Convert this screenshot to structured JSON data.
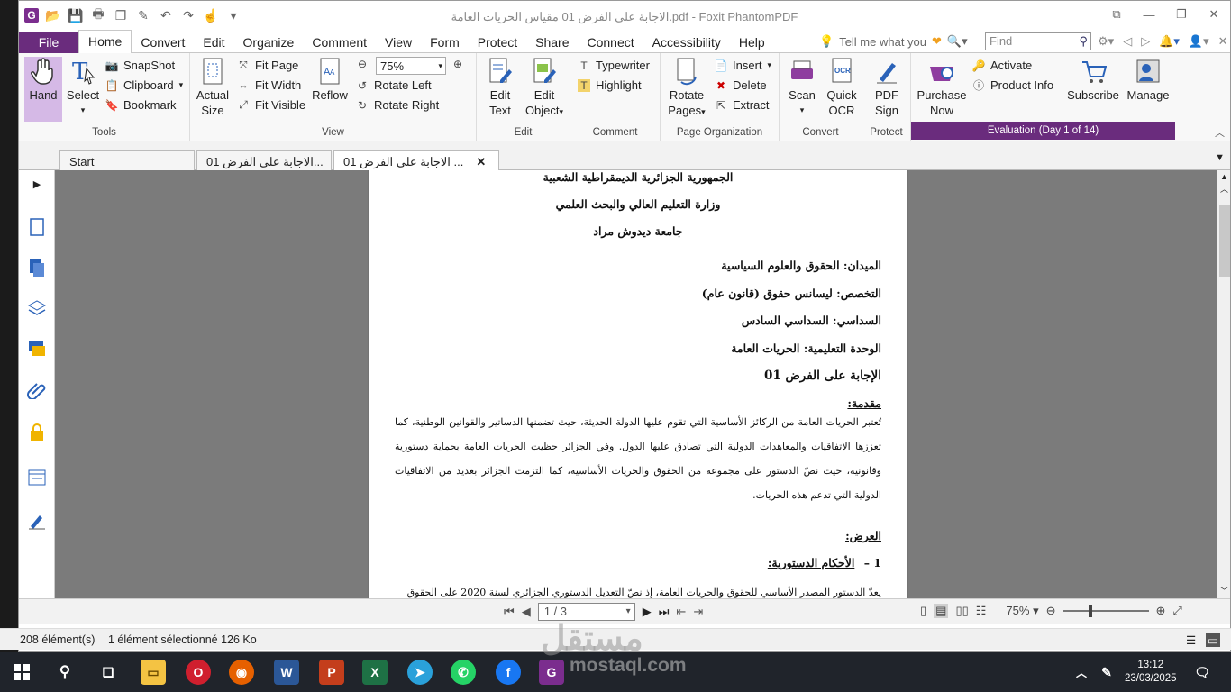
{
  "window": {
    "title": "الاجابة على الفرض 01 مقياس الحريات العامة.pdf - Foxit PhantomPDF"
  },
  "menu": {
    "tabs": [
      "File",
      "Home",
      "Convert",
      "Edit",
      "Organize",
      "Comment",
      "View",
      "Form",
      "Protect",
      "Share",
      "Connect",
      "Accessibility",
      "Help"
    ],
    "tell_me": "Tell me what you",
    "find_placeholder": "Find"
  },
  "ribbon": {
    "tools": {
      "label": "Tools",
      "hand": "Hand",
      "select": "Select",
      "snapshot": "SnapShot",
      "clipboard": "Clipboard",
      "bookmark": "Bookmark"
    },
    "view": {
      "label": "View",
      "actual_size_1": "Actual",
      "actual_size_2": "Size",
      "fit_page": "Fit Page",
      "fit_width": "Fit Width",
      "fit_visible": "Fit Visible",
      "reflow": "Reflow",
      "zoom": "75%",
      "rotate_left": "Rotate Left",
      "rotate_right": "Rotate Right"
    },
    "edit": {
      "label": "Edit",
      "edit_text_1": "Edit",
      "edit_text_2": "Text",
      "edit_object_1": "Edit",
      "edit_object_2": "Object"
    },
    "comment": {
      "label": "Comment",
      "typewriter": "Typewriter",
      "highlight": "Highlight"
    },
    "organize": {
      "label": "Page Organization",
      "rotate_pages_1": "Rotate",
      "rotate_pages_2": "Pages",
      "insert": "Insert",
      "delete": "Delete",
      "extract": "Extract"
    },
    "convert": {
      "label": "Convert",
      "scan": "Scan",
      "quick_ocr_1": "Quick",
      "quick_ocr_2": "OCR"
    },
    "protect": {
      "label": "Protect",
      "pdf_sign_1": "PDF",
      "pdf_sign_2": "Sign"
    },
    "purchase": {
      "purchase_1": "Purchase",
      "purchase_2": "Now",
      "activate": "Activate",
      "product_info": "Product Info",
      "subscribe": "Subscribe",
      "manage": "Manage",
      "evaluation": "Evaluation (Day 1 of 14)"
    }
  },
  "doc_tabs": [
    "Start",
    "الاجابة على الفرض 01...",
    "الاجابة على الفرض 01 ..."
  ],
  "document": {
    "header1": "الجمهورية الجزائرية الديمقراطية الشعبية",
    "header2": "وزارة التعليم العالي والبحث العلمي",
    "header3": "جامعة ديدوش مراد",
    "field": "الميدان: الحقوق والعلوم السياسية",
    "specialty": "التخصص: ليسانس حقوق (قانون عام)",
    "semester": "السداسي: السداسي السادس",
    "unit": "الوحدة التعليمية: الحريات العامة",
    "answer_title": "الإجابة على الفرض 01",
    "intro_heading": "مقدمة:",
    "intro_text": "تُعتبر الحريات العامة من الركائز الأساسية التي تقوم عليها الدولة الحديثة، حيث تضمنها الدساتير والقوانين الوطنية، كما تعززها الاتفاقيات والمعاهدات الدولية التي تصادق عليها الدول. وفي الجزائر حظيت الحريات العامة بحماية دستورية وقانونية، حيث نصّ الدستور على مجموعة من الحقوق والحريات الأساسية، كما التزمت الجزائر بعديد من الاتفاقيات الدولية التي تدعم هذه الحريات.",
    "body_heading": "العرض:",
    "section1_num": "1 –",
    "section1_title": "الأحكام الدستورية:",
    "section1_text": "يعدّ الدستور المصدر الأساسي للحقوق والحريات العامة، إذ نصّ التعديل الدستوري الجزائري لسنة 2020 على الحقوق"
  },
  "navigation": {
    "page": "1 / 3",
    "zoom": "75%"
  },
  "win_status": {
    "count": "208 élément(s)",
    "selected": "1 élément sélectionné  126 Ko"
  },
  "taskbar": {
    "time": "13:12",
    "date": "23/03/2025"
  },
  "watermark": {
    "arabic": "مستقل",
    "latin": "mostaql.com"
  }
}
